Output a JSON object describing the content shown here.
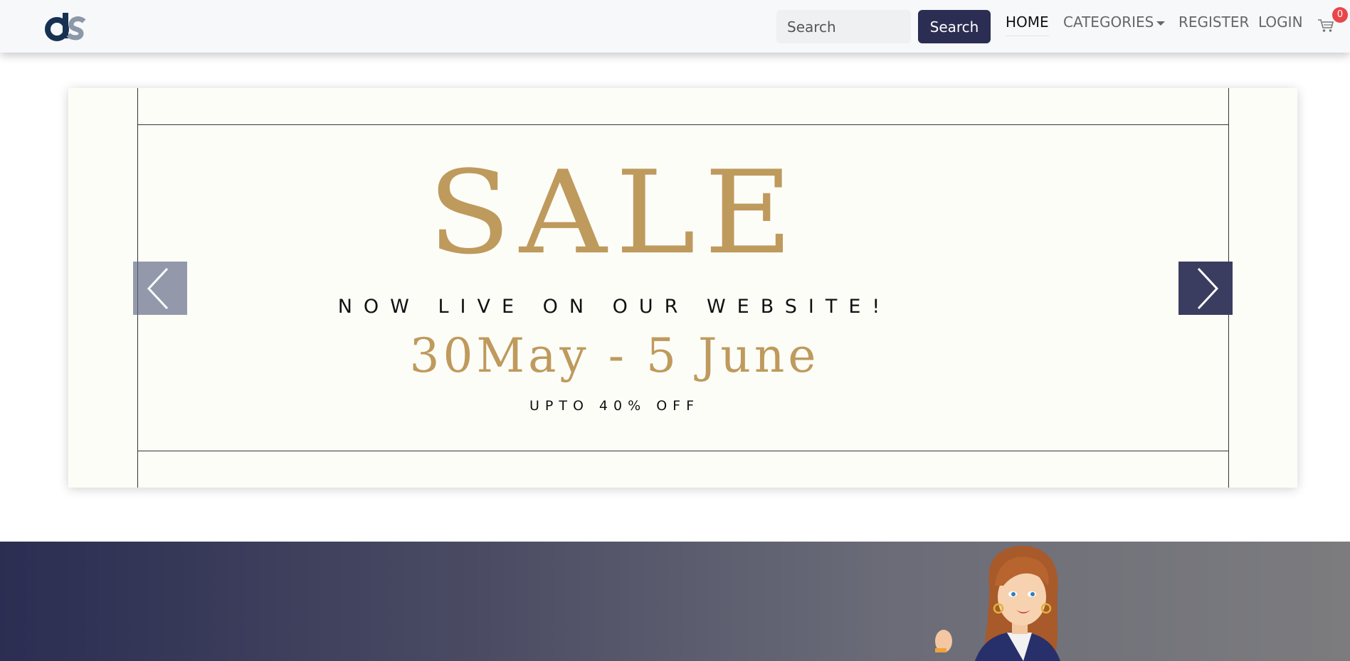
{
  "navbar": {
    "logo_text": "ds",
    "search": {
      "placeholder": "Search",
      "value": "",
      "button_label": "Search"
    },
    "links": {
      "home": "HOME",
      "categories": "CATEGORIES",
      "register": "REGISTER",
      "login": "LOGIN"
    },
    "cart": {
      "icon": "cart-icon",
      "count": "0"
    }
  },
  "carousel": {
    "slide": {
      "title": "SALE",
      "subtitle": "NOW LIVE ON OUR WEBSITE!",
      "dates": "30May - 5 June",
      "discount": "UPTO 40% OFF"
    },
    "prev_icon": "chevron-left-icon",
    "next_icon": "chevron-right-icon"
  },
  "hero": {
    "illustration": "woman-illustration"
  },
  "colors": {
    "primary": "#2b2d52",
    "gold": "#bf9a5d",
    "badge": "#e8474a",
    "slide_bg": "#fdfdf8"
  }
}
